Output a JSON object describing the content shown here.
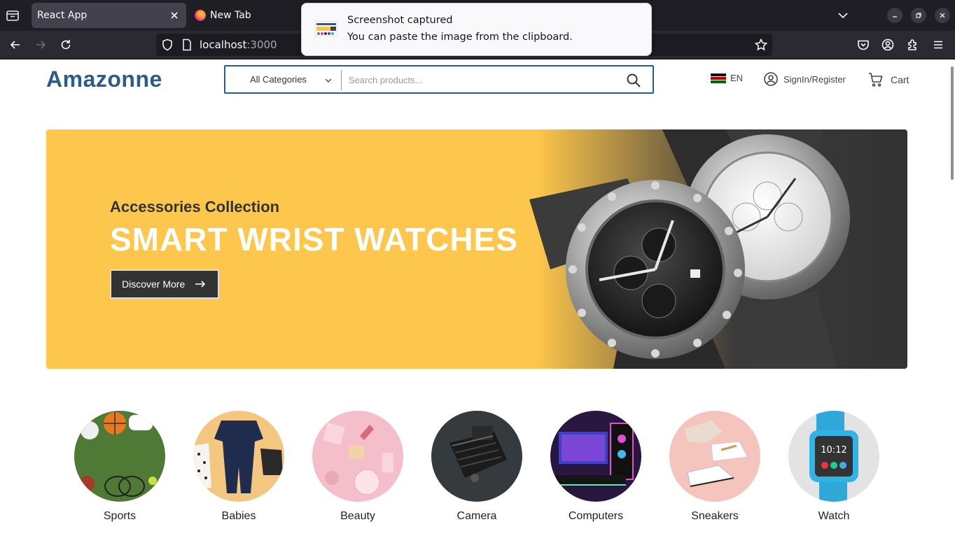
{
  "browser": {
    "tabs": [
      {
        "label": "React App"
      },
      {
        "label": "New Tab"
      }
    ],
    "url_host": "localhost",
    "url_port": ":3000"
  },
  "toast": {
    "title": "Screenshot captured",
    "message": "You can paste the image from the clipboard."
  },
  "header": {
    "logo": "Amazonne",
    "category_select": "All Categories",
    "search_placeholder": "Search products...",
    "language": "EN",
    "signin": "SignIn/Register",
    "cart": "Cart"
  },
  "hero": {
    "subtitle": "Accessories Collection",
    "title": "SMART WRIST WATCHES",
    "button": "Discover More"
  },
  "categories": [
    {
      "label": "Sports"
    },
    {
      "label": "Babies"
    },
    {
      "label": "Beauty"
    },
    {
      "label": "Camera"
    },
    {
      "label": "Computers"
    },
    {
      "label": "Sneakers"
    },
    {
      "label": "Watch"
    }
  ],
  "colors": {
    "brand": "#2c5b8d",
    "hero_yellow": "#fdc64c",
    "dark": "#333333"
  }
}
